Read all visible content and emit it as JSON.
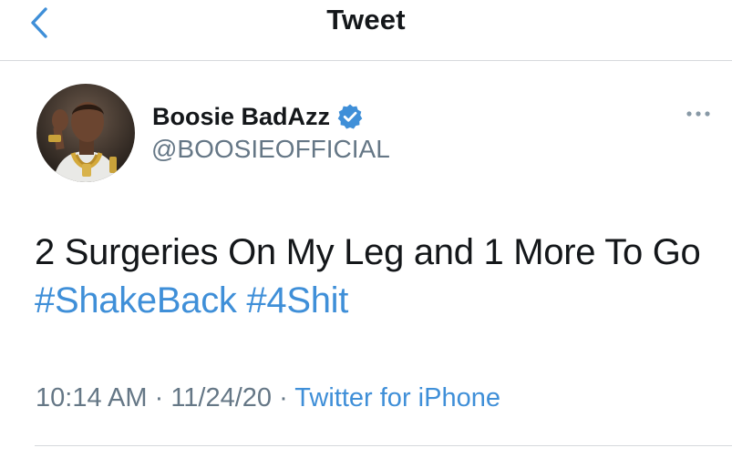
{
  "nav": {
    "title": "Tweet",
    "back_icon": "chevron-left-icon"
  },
  "author": {
    "name": "Boosie BadAzz",
    "handle": "@BOOSIEOFFICIAL",
    "verified": true,
    "verified_icon": "verified-badge-icon"
  },
  "more_icon": "more-ellipsis-icon",
  "tweet": {
    "text_part1": "2 Surgeries On My Leg and 1 More To Go ",
    "hashtags": [
      "#ShakeBack",
      "#4Shit"
    ]
  },
  "meta": {
    "time": "10:14 AM",
    "date": "11/24/20",
    "separator": " · ",
    "source": "Twitter for iPhone"
  },
  "colors": {
    "accent": "#3f8fd8",
    "text": "#14171a",
    "secondary": "#657786",
    "divider": "#d6d9dc"
  }
}
